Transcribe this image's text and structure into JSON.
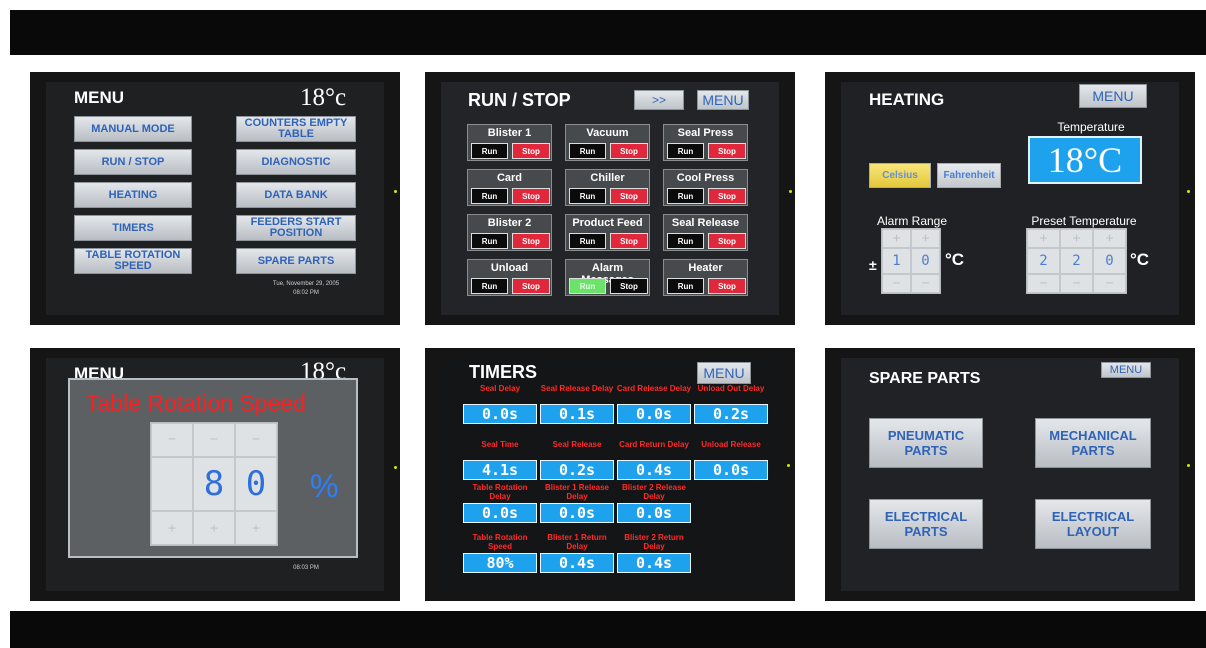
{
  "menu_panel": {
    "title": "MENU",
    "temperature": "18°c",
    "left_buttons": [
      "MANUAL MODE",
      "RUN / STOP",
      "HEATING",
      "TIMERS",
      "TABLE ROTATION SPEED"
    ],
    "right_buttons": [
      "COUNTERS EMPTY TABLE",
      "DIAGNOSTIC",
      "DATA BANK",
      "FEEDERS START POSITION",
      "SPARE PARTS"
    ],
    "date": "Tue, November 29, 2005",
    "time": "08:02 PM"
  },
  "run_stop_panel": {
    "title": "RUN / STOP",
    "next_label": ">>",
    "menu_label": "MENU",
    "items": [
      {
        "label": "Blister 1",
        "run": "Run",
        "stop": "Stop"
      },
      {
        "label": "Vacuum",
        "run": "Run",
        "stop": "Stop"
      },
      {
        "label": "Seal Press",
        "run": "Run",
        "stop": "Stop"
      },
      {
        "label": "Card",
        "run": "Run",
        "stop": "Stop"
      },
      {
        "label": "Chiller",
        "run": "Run",
        "stop": "Stop"
      },
      {
        "label": "Cool Press",
        "run": "Run",
        "stop": "Stop"
      },
      {
        "label": "Blister 2",
        "run": "Run",
        "stop": "Stop"
      },
      {
        "label": "Product Feed",
        "run": "Run",
        "stop": "Stop"
      },
      {
        "label": "Seal Release",
        "run": "Run",
        "stop": "Stop"
      },
      {
        "label": "Unload",
        "run": "Run",
        "stop": "Stop"
      },
      {
        "label": "Alarm Messages",
        "run": "Run",
        "stop": "Stop"
      },
      {
        "label": "Heater",
        "run": "Run",
        "stop": "Stop"
      }
    ]
  },
  "heating_panel": {
    "title": "HEATING",
    "menu_label": "MENU",
    "temperature_label": "Temperature",
    "temperature_value": "18°C",
    "celsius_label": "Celsius",
    "fahrenheit_label": "Fahrenheit",
    "alarm_range_label": "Alarm Range",
    "alarm_sign": "±",
    "alarm_digits": [
      "1",
      "0"
    ],
    "alarm_unit": "°C",
    "preset_label": "Preset Temperature",
    "preset_digits": [
      "2",
      "2",
      "0"
    ],
    "preset_unit": "°C"
  },
  "speed_panel": {
    "background_title": "MENU",
    "background_temp": "18°c",
    "title": "Table Rotation Speed",
    "digits": [
      "8",
      "0"
    ],
    "unit": "%",
    "time": "08:03 PM"
  },
  "timers_panel": {
    "title": "TIMERS",
    "menu_label": "MENU",
    "items": [
      {
        "label": "Seal Delay",
        "value": "0.0s"
      },
      {
        "label": "Seal Release Delay",
        "value": "0.1s"
      },
      {
        "label": "Card Release Delay",
        "value": "0.0s"
      },
      {
        "label": "Unload Out Delay",
        "value": "0.2s"
      },
      {
        "label": "Seal Time",
        "value": "4.1s"
      },
      {
        "label": "Seal Release",
        "value": "0.2s"
      },
      {
        "label": "Card Return Delay",
        "value": "0.4s"
      },
      {
        "label": "Unload Release",
        "value": "0.0s"
      },
      {
        "label": "Table Rotation Delay",
        "value": "0.0s"
      },
      {
        "label": "Blister 1 Release Delay",
        "value": "0.0s"
      },
      {
        "label": "Blister 2 Release Delay",
        "value": "0.0s"
      },
      {
        "label": "Table Rotation Speed",
        "value": "80%"
      },
      {
        "label": "Blister 1 Return Delay",
        "value": "0.4s"
      },
      {
        "label": "Blister 2 Return Delay",
        "value": "0.4s"
      }
    ]
  },
  "spare_parts_panel": {
    "title": "SPARE PARTS",
    "menu_label": "MENU",
    "buttons": [
      "PNEUMATIC PARTS",
      "MECHANICAL PARTS",
      "ELECTRICAL PARTS",
      "ELECTRICAL LAYOUT"
    ]
  },
  "colors": {
    "accent_blue": "#2f63b8",
    "screen_blue": "#1ea2ee",
    "stop_red": "#e0283c",
    "run_green": "#6be36b",
    "title_red": "#ff2a2a"
  }
}
